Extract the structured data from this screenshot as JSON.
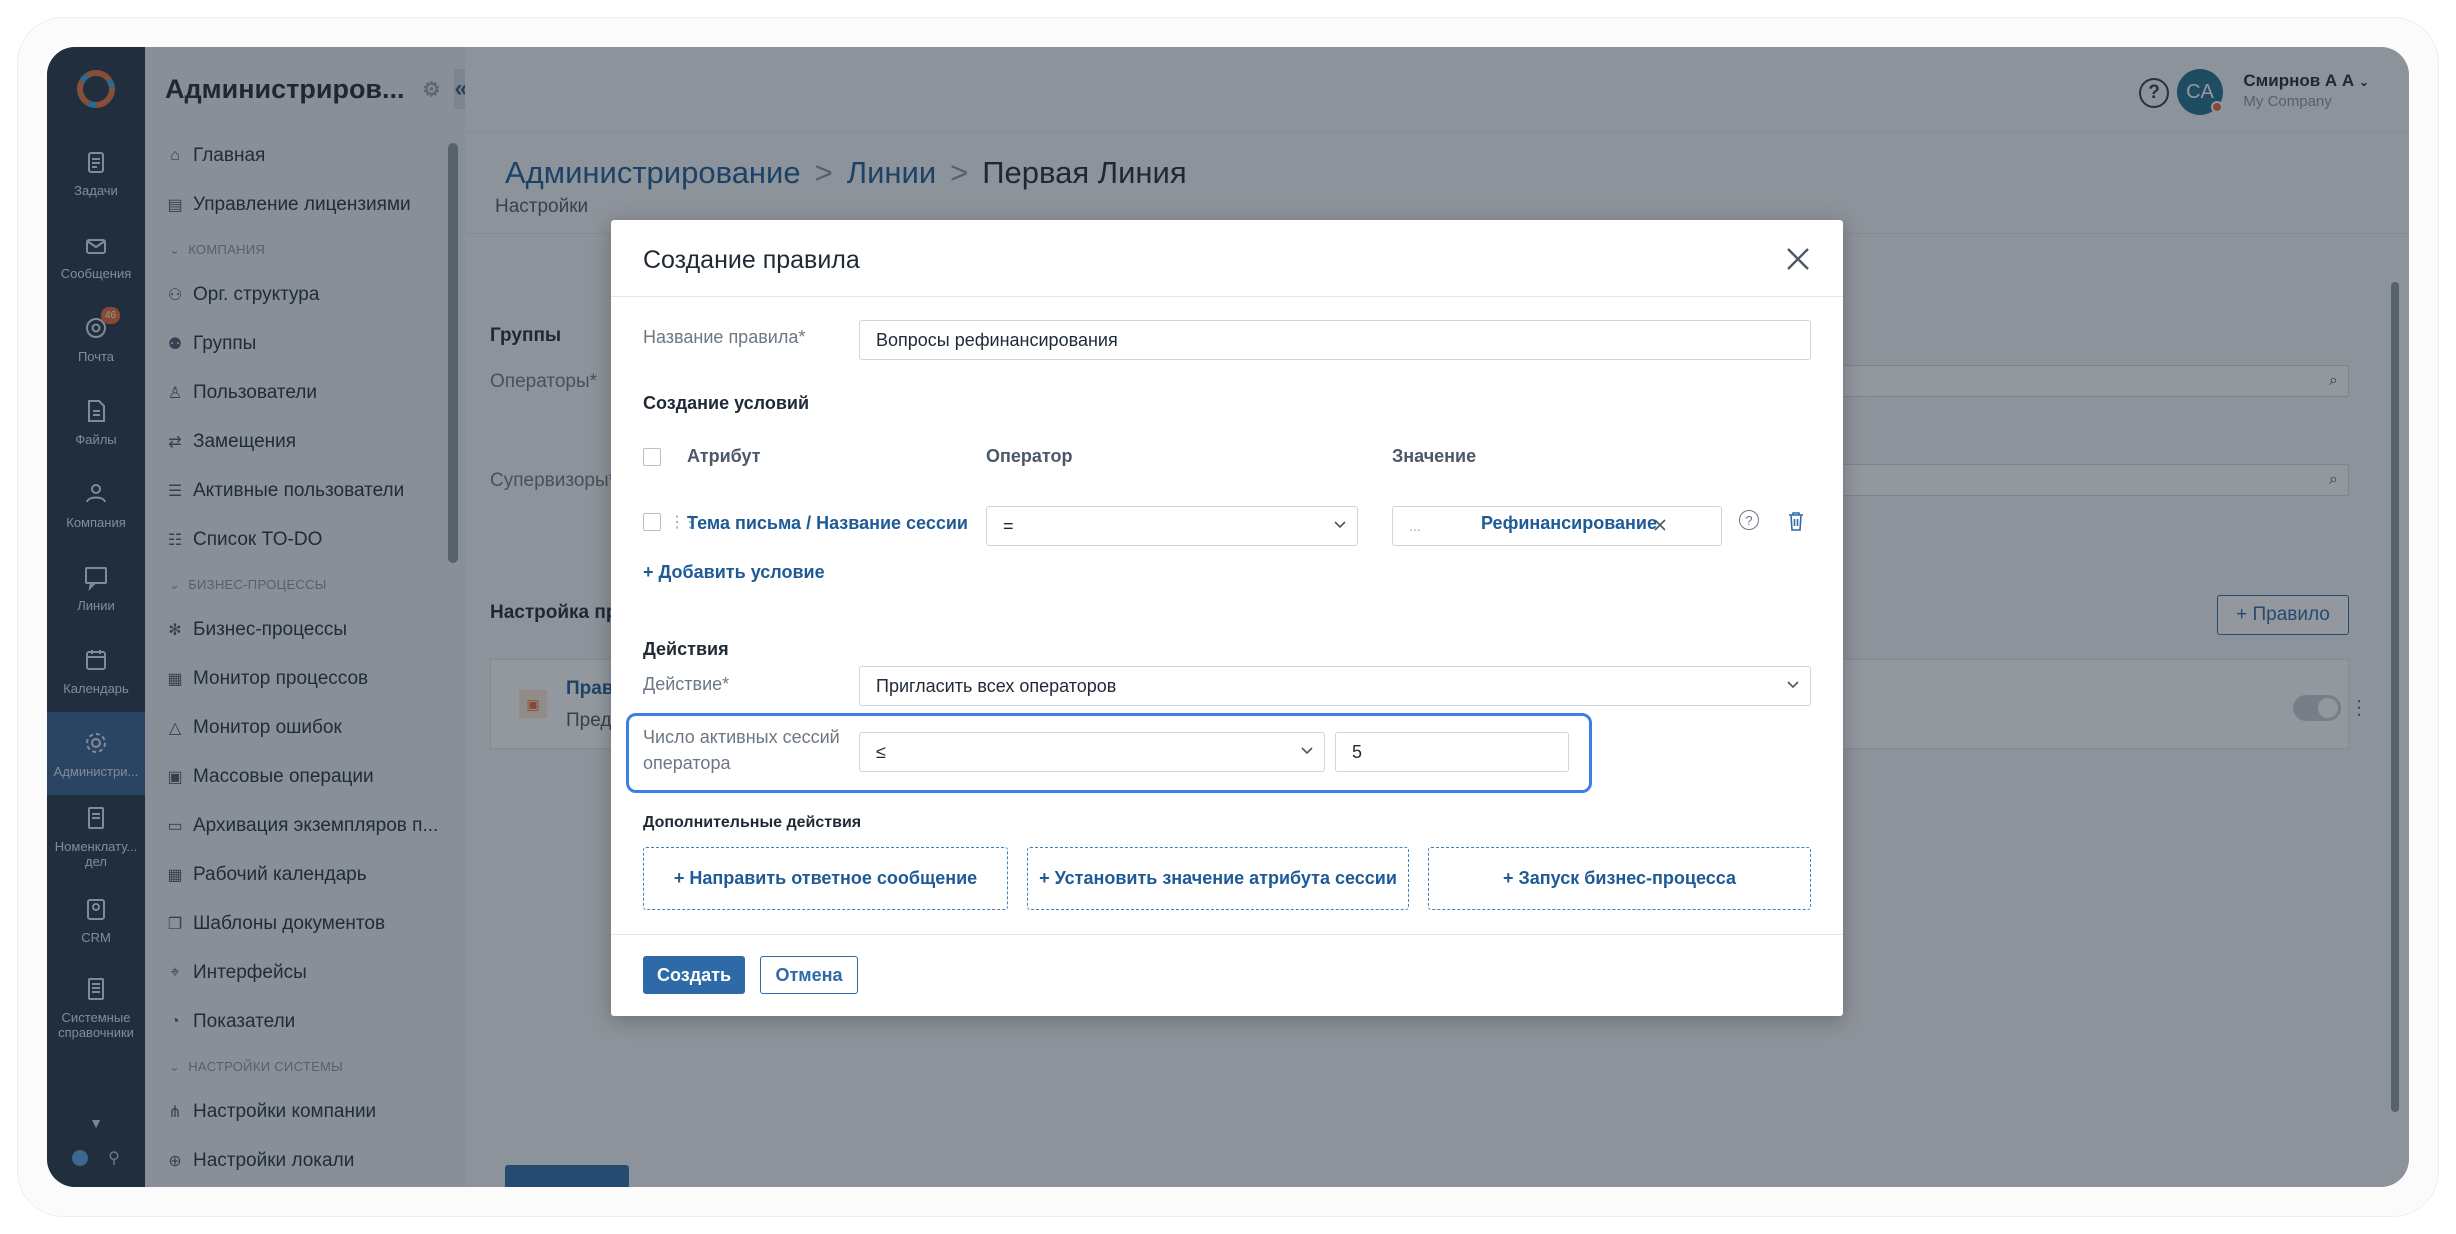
{
  "rail": {
    "items": [
      {
        "label": "Задачи",
        "icon": "clipboard-icon"
      },
      {
        "label": "Сообщения",
        "icon": "messages-icon"
      },
      {
        "label": "Почта",
        "icon": "at-icon",
        "badge": "46"
      },
      {
        "label": "Файлы",
        "icon": "file-icon"
      },
      {
        "label": "Компания",
        "icon": "company-icon"
      },
      {
        "label": "Линии",
        "icon": "chat-icon"
      },
      {
        "label": "Календарь",
        "icon": "calendar-icon"
      },
      {
        "label": "Администри...",
        "icon": "gear-icon"
      },
      {
        "label": "Номенклату... дел",
        "icon": "book-icon"
      },
      {
        "label": "CRM",
        "icon": "crm-icon"
      },
      {
        "label": "Системные справочники",
        "icon": "directory-icon"
      }
    ]
  },
  "sidebar": {
    "title": "Администриров...",
    "items": [
      {
        "type": "item",
        "label": "Главная",
        "icon": "home-icon"
      },
      {
        "type": "item",
        "label": "Управление лицензиями",
        "icon": "license-icon"
      },
      {
        "type": "section",
        "label": "КОМПАНИЯ"
      },
      {
        "type": "item",
        "label": "Орг. структура",
        "icon": "org-icon"
      },
      {
        "type": "item",
        "label": "Группы",
        "icon": "group-icon"
      },
      {
        "type": "item",
        "label": "Пользователи",
        "icon": "user-icon"
      },
      {
        "type": "item",
        "label": "Замещения",
        "icon": "swap-icon"
      },
      {
        "type": "item",
        "label": "Активные пользователи",
        "icon": "active-users-icon"
      },
      {
        "type": "item",
        "label": "Список TO-DO",
        "icon": "list-icon"
      },
      {
        "type": "section",
        "label": "БИЗНЕС-ПРОЦЕССЫ"
      },
      {
        "type": "item",
        "label": "Бизнес-процессы",
        "icon": "process-icon"
      },
      {
        "type": "item",
        "label": "Монитор процессов",
        "icon": "monitor-icon"
      },
      {
        "type": "item",
        "label": "Монитор ошибок",
        "icon": "warning-icon"
      },
      {
        "type": "item",
        "label": "Массовые операции",
        "icon": "mass-icon"
      },
      {
        "type": "item",
        "label": "Архивация экземпляров п...",
        "icon": "archive-icon"
      },
      {
        "type": "item",
        "label": "Рабочий календарь",
        "icon": "calendar-icon"
      },
      {
        "type": "item",
        "label": "Шаблоны документов",
        "icon": "template-icon"
      },
      {
        "type": "item",
        "label": "Интерфейсы",
        "icon": "interface-icon"
      },
      {
        "type": "item",
        "label": "Показатели",
        "icon": "gauge-icon"
      },
      {
        "type": "section",
        "label": "НАСТРОЙКИ СИСТЕМЫ"
      },
      {
        "type": "item",
        "label": "Настройки компании",
        "icon": "settings-icon"
      },
      {
        "type": "item",
        "label": "Настройки локали",
        "icon": "globe-icon"
      }
    ]
  },
  "user": {
    "initials": "CA",
    "name": "Смирнов А А",
    "company": "My Company"
  },
  "breadcrumb": {
    "part1": "Администрирование",
    "part2": "Линии",
    "current": "Первая Линия",
    "sep": ">"
  },
  "background": {
    "tab": "Настройки",
    "groups": "Группы",
    "operators": "Операторы*",
    "supervisors": "Супервизоры*",
    "rules_title": "Настройка пра",
    "rule_button": "+ Правило",
    "rule_name": "Прав",
    "rule_desc": "Пред"
  },
  "modal": {
    "title": "Создание правила",
    "rule_name_label": "Название правила*",
    "rule_name_value": "Вопросы рефинансирования",
    "conditions_title": "Создание условий",
    "col_attribute": "Атрибут",
    "col_operator": "Оператор",
    "col_value": "Значение",
    "condition": {
      "attribute": "Тема письма / Название сессии",
      "operator": "=",
      "value_prefix": "...",
      "value": "Рефинансирование"
    },
    "add_condition": "+ Добавить условие",
    "actions_title": "Действия",
    "action_label": "Действие*",
    "action_value": "Пригласить всех операторов",
    "sessions_label": "Число активных сессий оператора",
    "sessions_operator": "≤",
    "sessions_value": "5",
    "extra_title": "Дополнительные действия",
    "extra_buttons": [
      "+ Направить ответное сообщение",
      "+ Установить значение атрибута сессии",
      "+ Запуск бизнес-процесса"
    ],
    "create": "Создать",
    "cancel": "Отмена"
  }
}
